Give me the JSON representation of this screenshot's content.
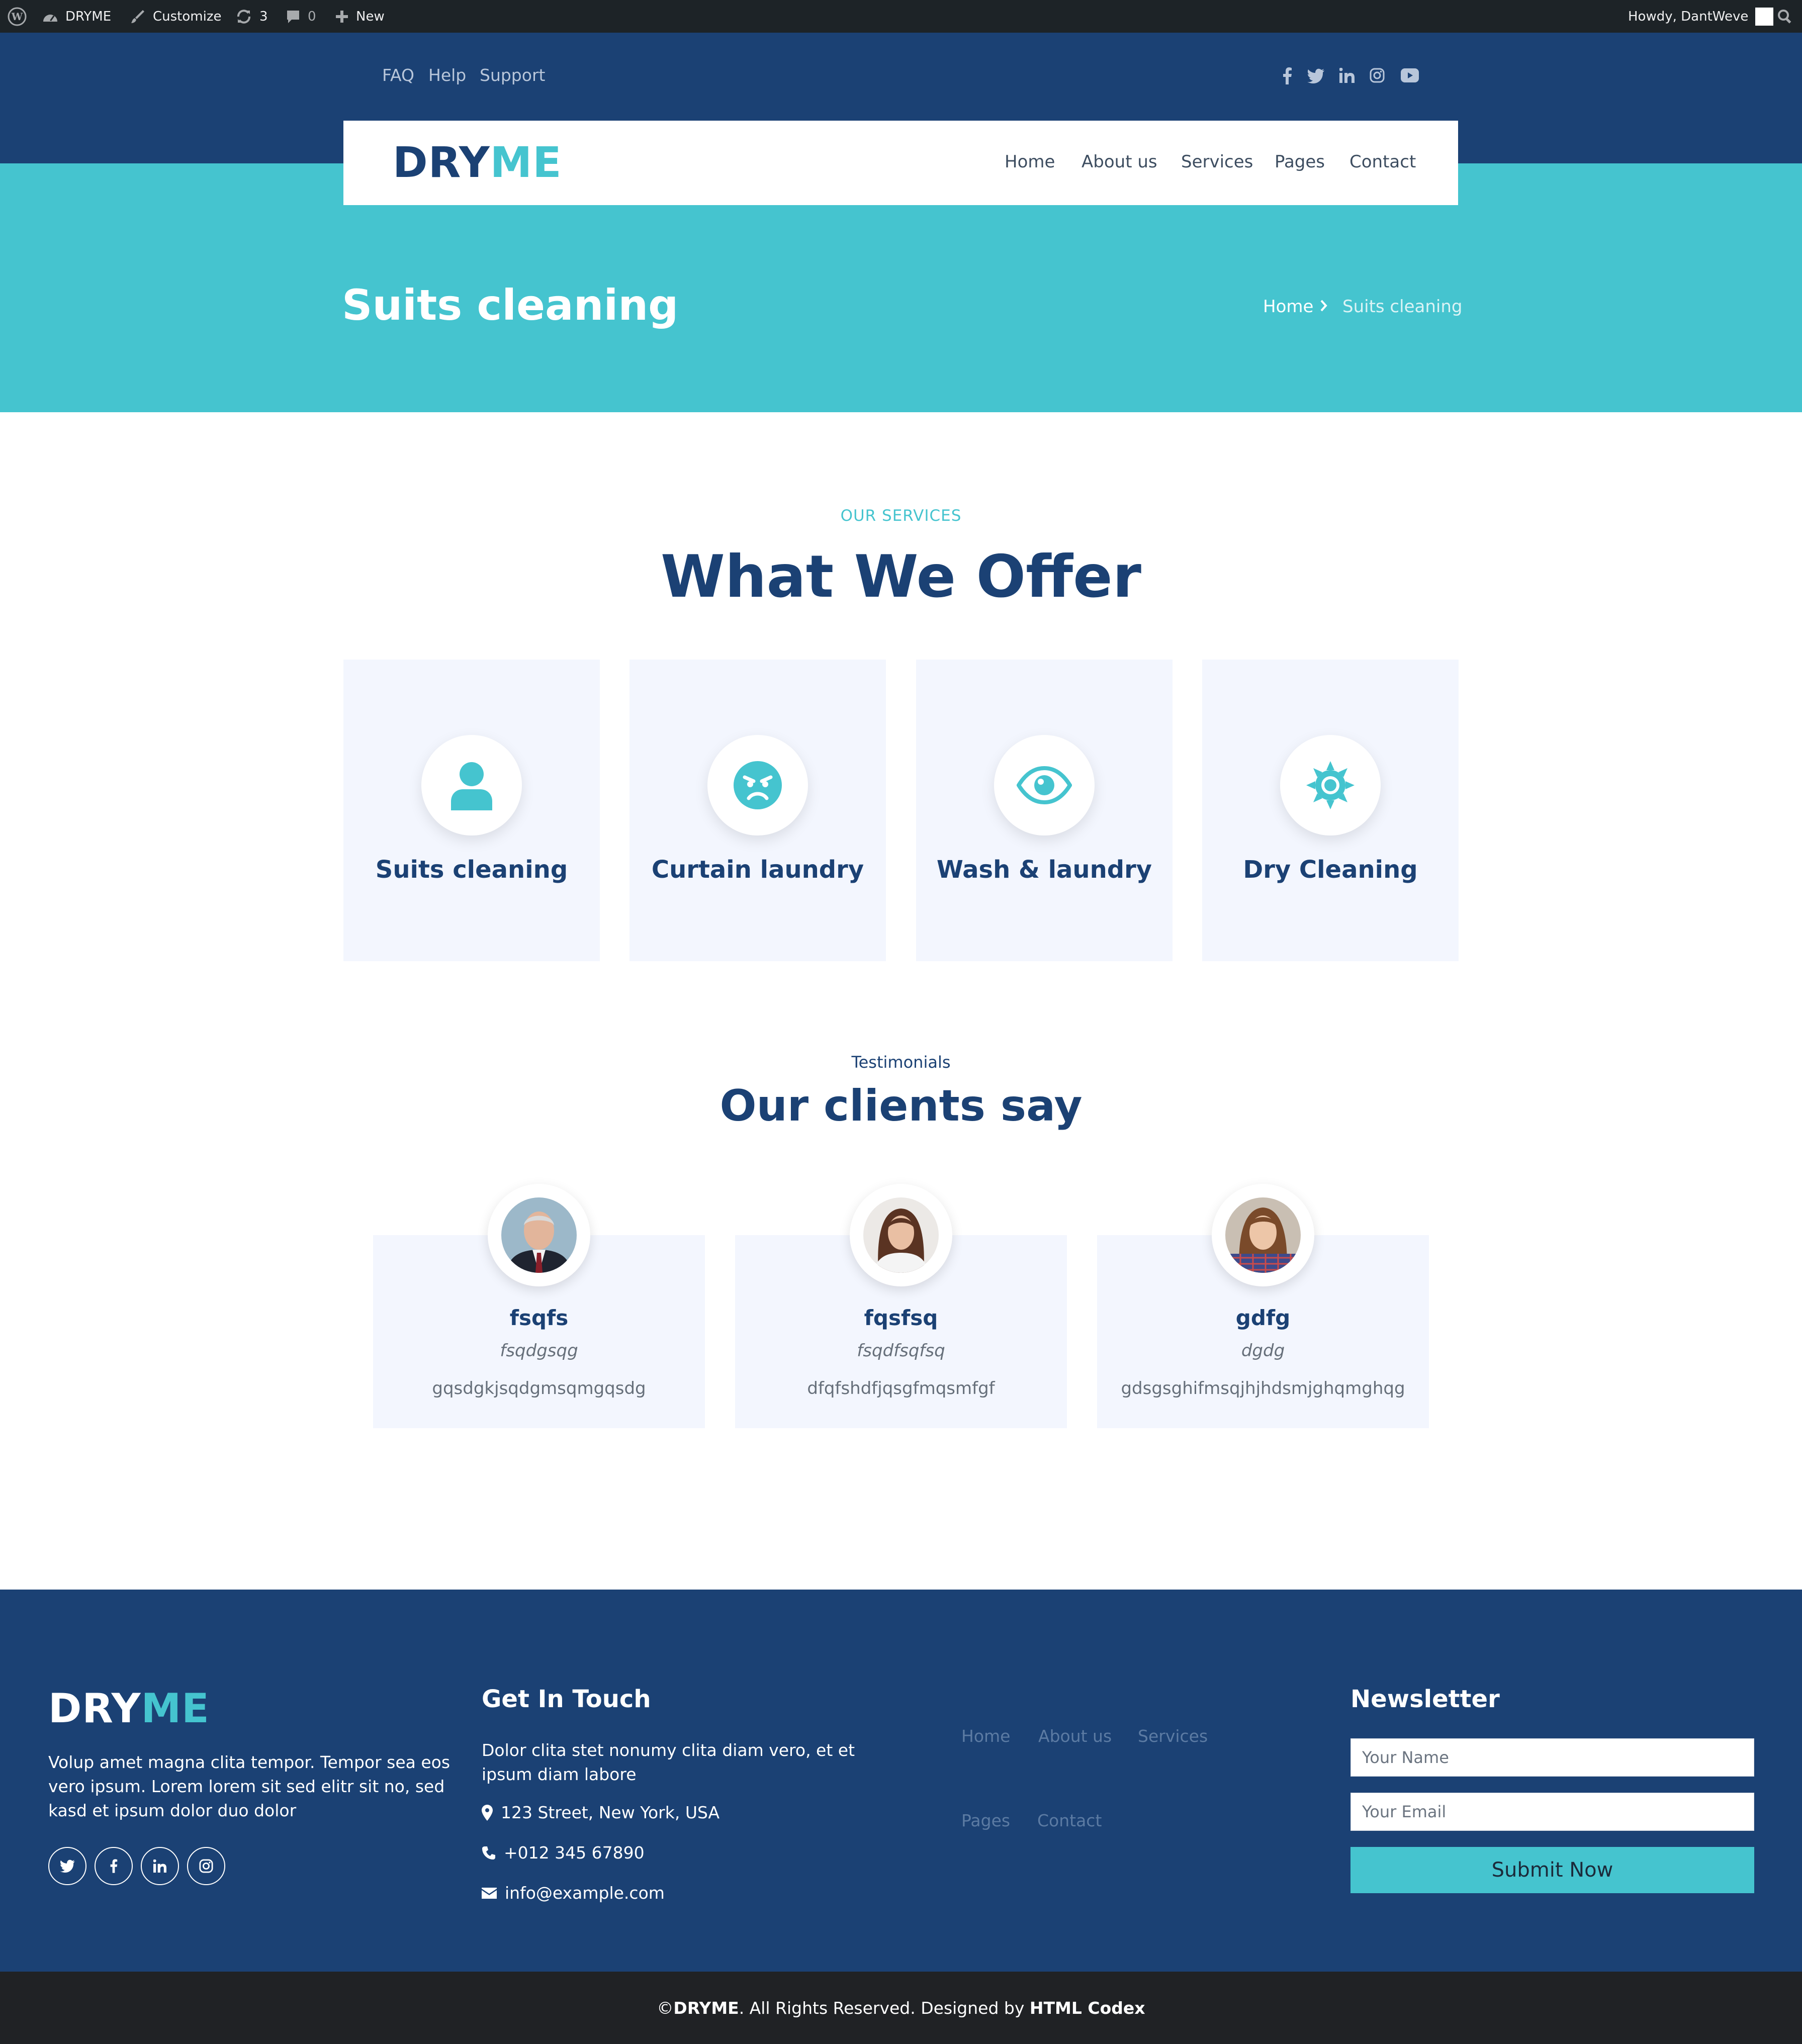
{
  "admin_bar": {
    "site_name": "DRYME",
    "customize": "Customize",
    "updates": "3",
    "comments": "0",
    "new": "New",
    "greeting": "Howdy, DantWeve"
  },
  "topbar": {
    "links": [
      "FAQ",
      "Help",
      "Support"
    ],
    "social_icons": [
      "facebook-icon",
      "twitter-icon",
      "linkedin-icon",
      "instagram-icon",
      "youtube-icon"
    ]
  },
  "brand": {
    "part1": "DRY",
    "part2": "ME"
  },
  "nav": {
    "items": [
      "Home",
      "About us",
      "Services",
      "Pages",
      "Contact"
    ]
  },
  "hero": {
    "title": "Suits cleaning",
    "breadcrumb": {
      "home": "Home",
      "current": "Suits cleaning"
    }
  },
  "services": {
    "eyebrow": "OUR SERVICES",
    "heading": "What We Offer",
    "items": [
      {
        "title": "Suits cleaning",
        "icon": "user-icon"
      },
      {
        "title": "Curtain laundry",
        "icon": "angry-face-icon"
      },
      {
        "title": "Wash & laundry",
        "icon": "eye-icon"
      },
      {
        "title": "Dry Cleaning",
        "icon": "sun-gear-icon"
      }
    ]
  },
  "testimonials": {
    "eyebrow": "Testimonials",
    "heading": "Our clients say",
    "items": [
      {
        "name": "fsqfs",
        "profession": "fsqdgsqg",
        "text": "gqsdgkjsqdgmsqmgqsdg"
      },
      {
        "name": "fqsfsq",
        "profession": "fsqdfsqfsq",
        "text": "dfqfshdfjqsgfmqsmfgf"
      },
      {
        "name": "gdfg",
        "profession": "dgdg",
        "text": "gdsgsghifmsqjhjhdsmjghqmghqg"
      }
    ]
  },
  "footer": {
    "about": "Volup amet magna clita tempor. Tempor sea eos vero ipsum. Lorem lorem sit sed elitr sit no, sed kasd et ipsum dolor duo dolor",
    "social_icons": [
      "twitter-icon",
      "facebook-icon",
      "linkedin-icon",
      "instagram-icon"
    ],
    "contact": {
      "heading": "Get In Touch",
      "text": "Dolor clita stet nonumy clita diam vero, et et ipsum diam labore",
      "address": "123 Street, New York, USA",
      "phone": "+012 345 67890",
      "email": "info@example.com"
    },
    "links": [
      "Home",
      "About us",
      "Services",
      "Pages",
      "Contact"
    ],
    "newsletter": {
      "heading": "Newsletter",
      "name_placeholder": "Your Name",
      "email_placeholder": "Your Email",
      "button": "Submit Now"
    }
  },
  "copyright": {
    "prefix": "© ",
    "brand": "DRYME",
    "middle": ". All Rights Reserved. Designed by ",
    "designer": "HTML Codex"
  },
  "colors": {
    "navy": "#1b4174",
    "teal": "#45c4cf",
    "card_bg": "#f3f6fe",
    "admin_bar": "#1d2327",
    "copyright_bar": "#202225"
  }
}
